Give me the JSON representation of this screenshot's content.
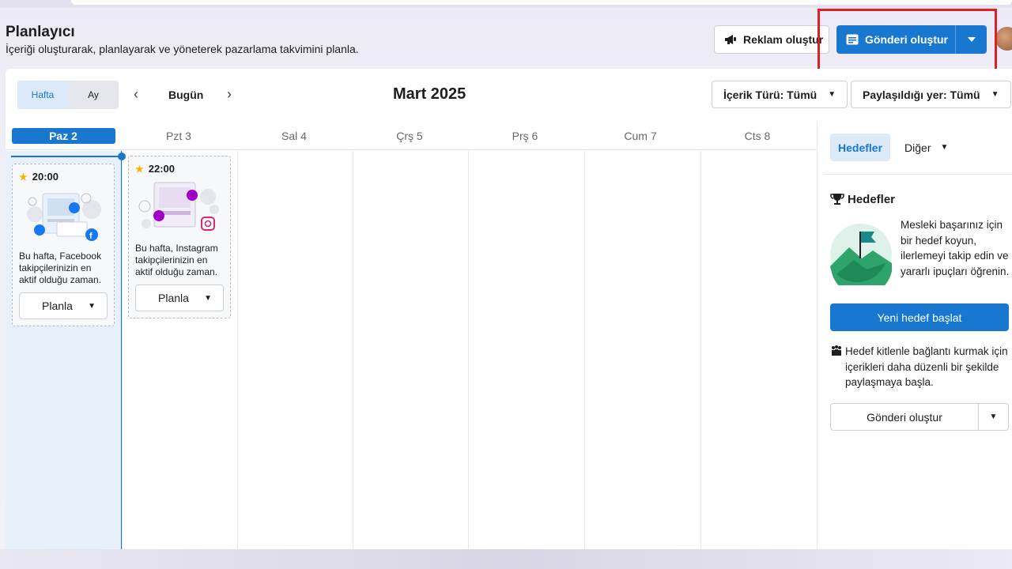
{
  "header": {
    "title": "Planlayıcı",
    "subtitle": "İçeriği oluşturarak, planlayarak ve yöneterek pazarlama takvimini planla.",
    "ad_button": "Reklam oluştur",
    "post_button": "Gönderi oluştur"
  },
  "toolbar": {
    "view_week": "Hafta",
    "view_month": "Ay",
    "today": "Bugün",
    "month_title": "Mart 2025",
    "filter_content": "İçerik Türü: Tümü",
    "filter_place": "Paylaşıldığı yer: Tümü"
  },
  "days": [
    "Paz 2",
    "Pzt 3",
    "Sal 4",
    "Çrş 5",
    "Prş 6",
    "Cum 7",
    "Cts 8"
  ],
  "cards": [
    {
      "time": "20:00",
      "message": "Bu hafta, Facebook takipçilerinizin en aktif olduğu zaman.",
      "button": "Planla",
      "network": "facebook"
    },
    {
      "time": "22:00",
      "message": "Bu hafta, Instagram takipçilerinizin en aktif olduğu zaman.",
      "button": "Planla",
      "network": "instagram"
    }
  ],
  "sidebar": {
    "tab_goals": "Hedefler",
    "tab_other": "Diğer",
    "goals_heading": "Hedefler",
    "goals_text": "Mesleki başarınız için bir hedef koyun, ilerlemeyi takip edin ve yararlı ipuçları öğrenin.",
    "goals_button": "Yeni hedef başlat",
    "audience_text": "Hedef kitlenle bağlantı kurmak için içerikleri daha düzenli bir şekilde paylaşmaya başla.",
    "post_button": "Gönderi oluştur"
  },
  "colors": {
    "accent": "#1877cf",
    "highlight": "#e01e2a"
  }
}
